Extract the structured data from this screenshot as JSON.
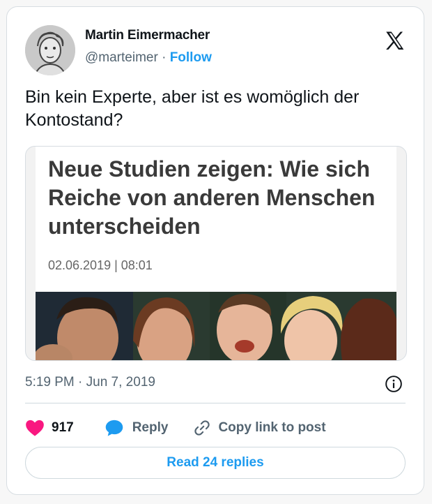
{
  "author": {
    "name": "Martin Eimermacher",
    "handle": "@marteimer",
    "separator": "·",
    "follow_label": "Follow"
  },
  "tweet": {
    "text": "Bin kein Experte, aber ist es womöglich der Kontostand?",
    "timestamp": "5:19 PM · Jun 7, 2019"
  },
  "article": {
    "headline": "Neue Studien zeigen: Wie sich Reiche von anderen Menschen unterscheiden",
    "date": "02.06.2019 | 08:01"
  },
  "actions": {
    "likes": "917",
    "reply_label": "Reply",
    "copy_label": "Copy link to post",
    "read_replies_label": "Read 24 replies"
  },
  "icons": {
    "brand": "x-logo-icon",
    "like": "heart-icon",
    "reply": "speech-bubble-icon",
    "copy": "link-icon",
    "info": "info-icon"
  },
  "colors": {
    "accent": "#1d9bf0",
    "heart": "#f91880",
    "muted": "#536471"
  }
}
